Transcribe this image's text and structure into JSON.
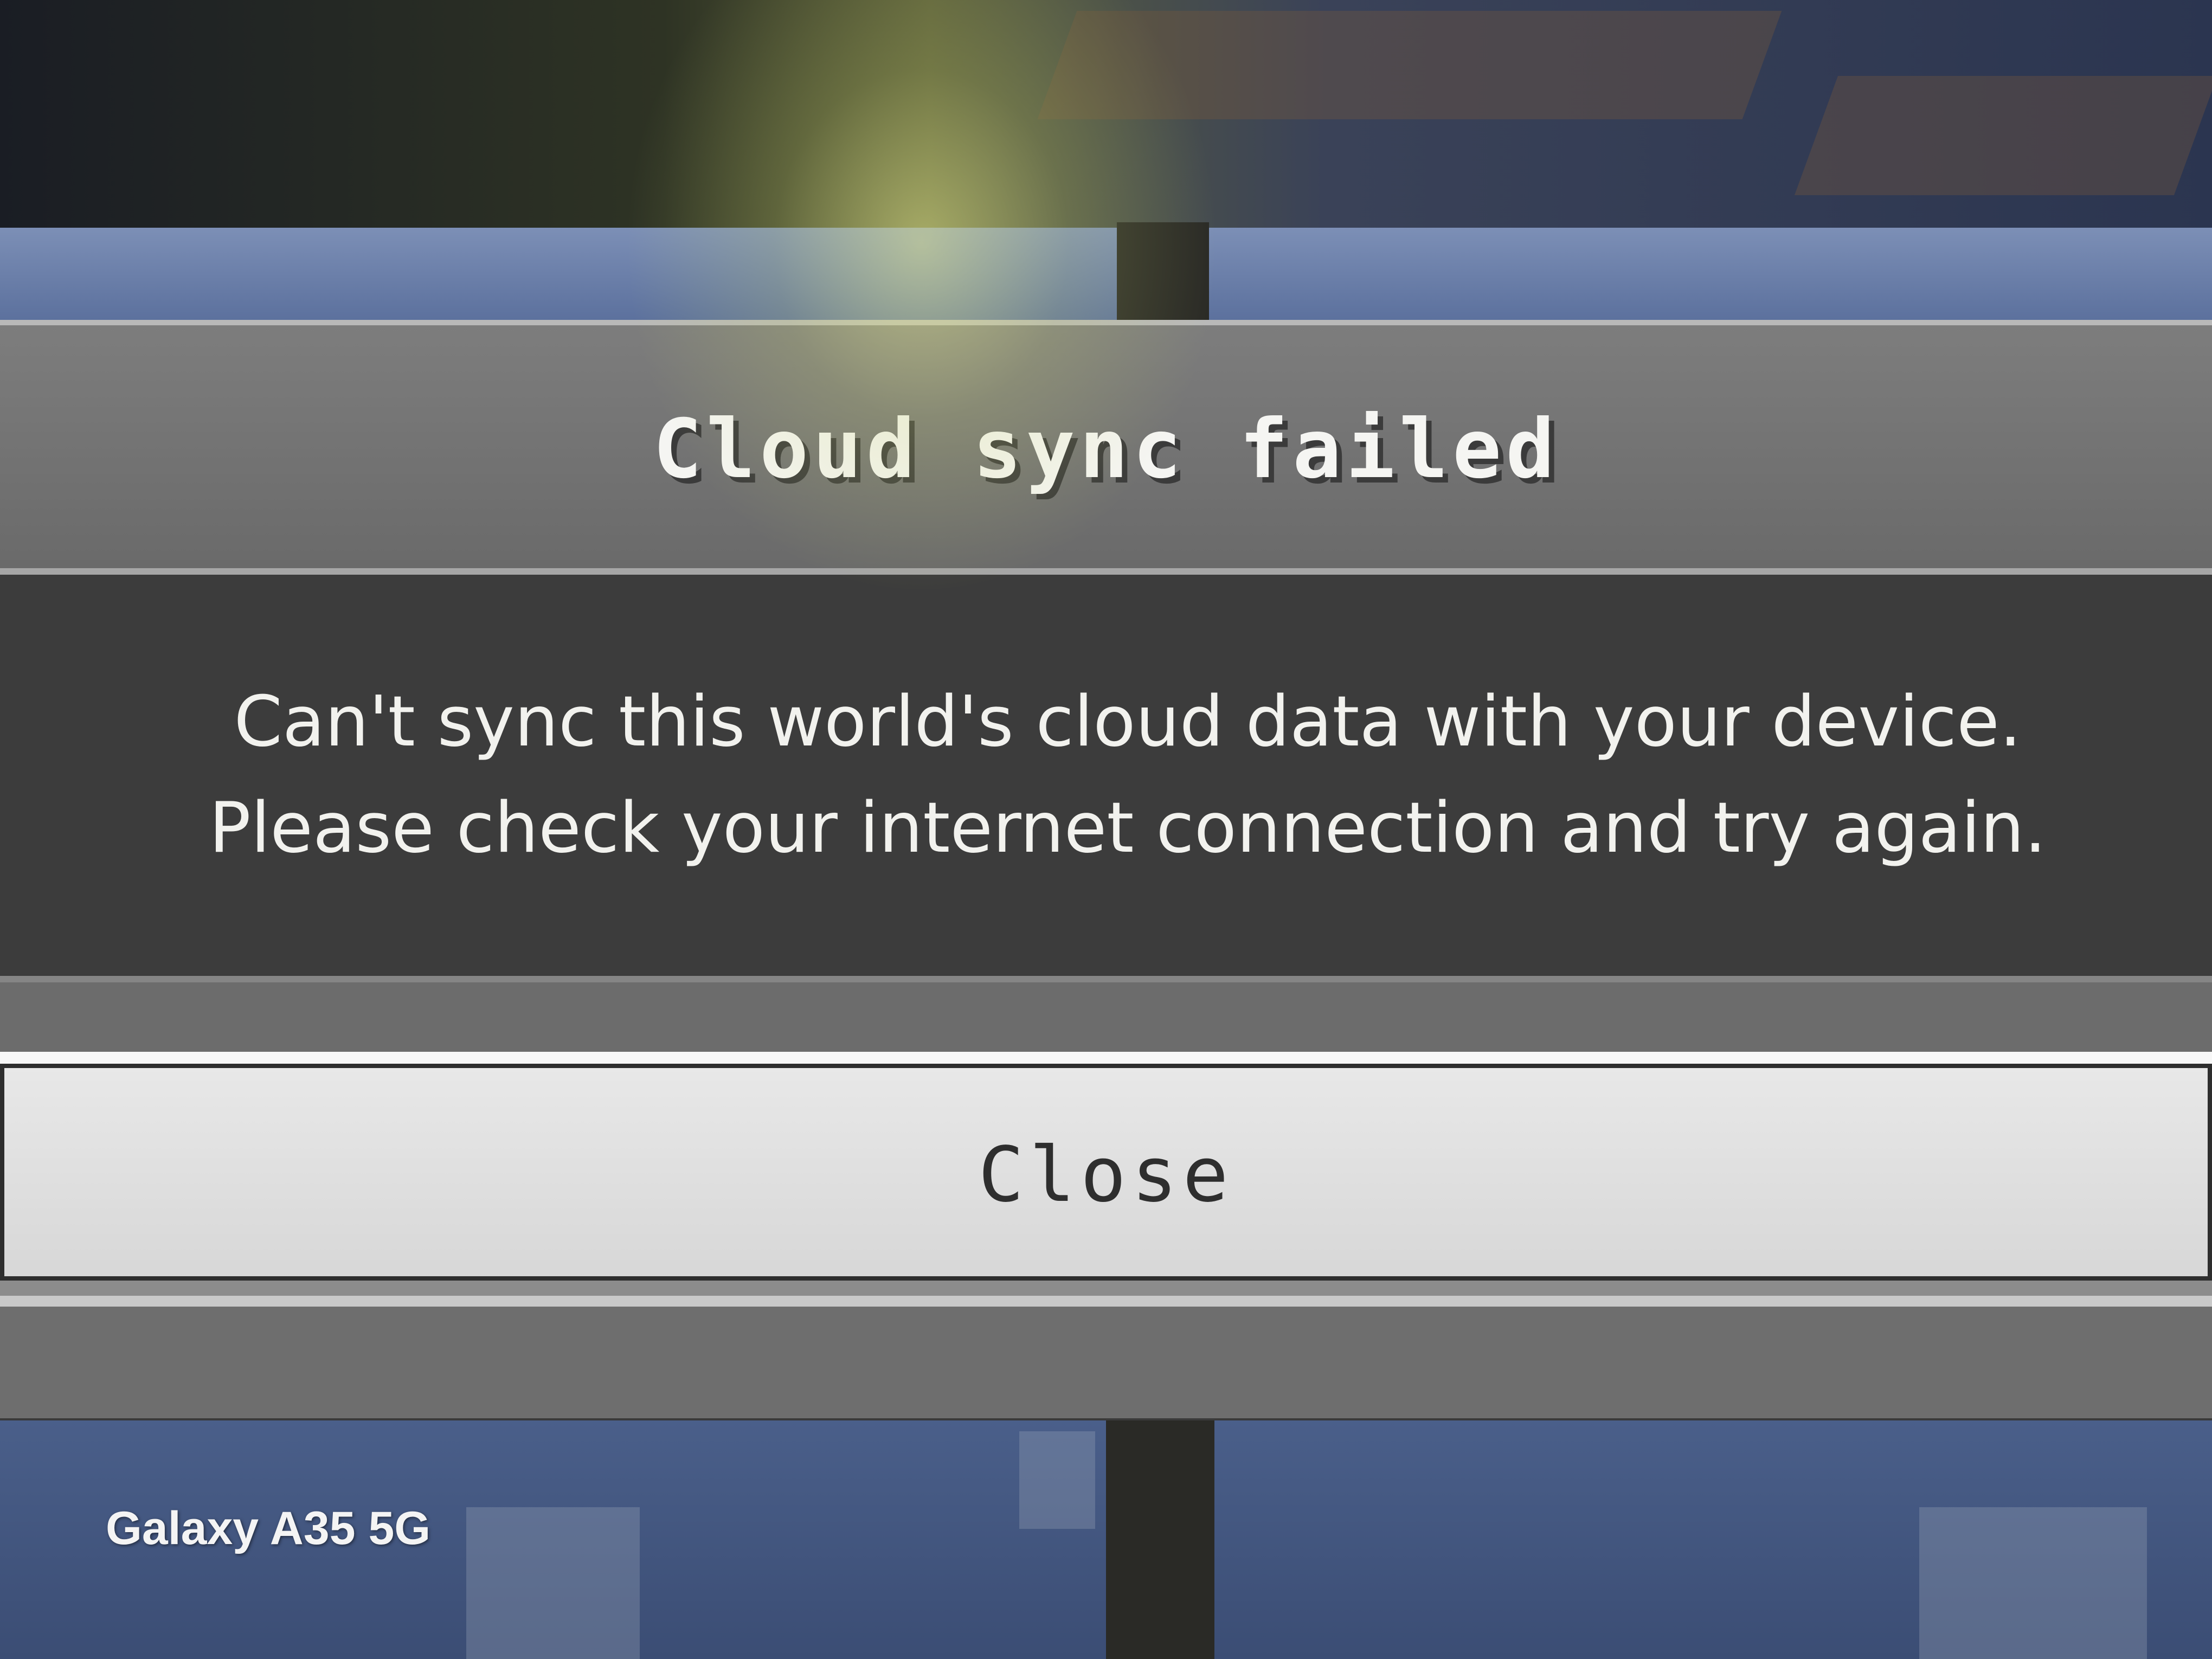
{
  "dialog": {
    "title": "Cloud sync failed",
    "message": "Can't sync this world's cloud data with your device. Please check your internet connection and try again.",
    "close_label": "Close"
  },
  "watermark": {
    "text": "Galaxy A35 5G"
  },
  "colors": {
    "dialog_header": "#7d7d7d",
    "dialog_body": "#3c3c3c",
    "button_face": "#e0e0e0",
    "title_text": "#f5f5f2",
    "button_text": "#2e2e2e"
  }
}
